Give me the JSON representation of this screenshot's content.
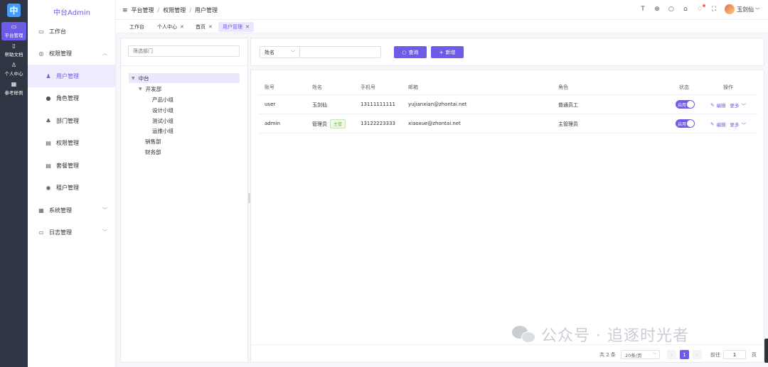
{
  "rail": {
    "logo": "中",
    "items": [
      {
        "label": "平台管理",
        "icon": "monitor-icon",
        "glyph": "▭",
        "active": true
      },
      {
        "label": "帮助文档",
        "icon": "document-icon",
        "glyph": "▯",
        "active": false
      },
      {
        "label": "个人中心",
        "icon": "person-icon",
        "glyph": "♙",
        "active": false
      },
      {
        "label": "参考样例",
        "icon": "grid-icon",
        "glyph": "▦",
        "active": false
      }
    ]
  },
  "menu": {
    "title": "中台Admin",
    "items": [
      {
        "label": "工作台",
        "glyph": "▭"
      },
      {
        "label": "权限管理",
        "glyph": "◎"
      },
      {
        "label": "用户管理",
        "glyph": "♟"
      },
      {
        "label": "角色管理",
        "glyph": "●"
      },
      {
        "label": "部门管理",
        "glyph": "♣"
      },
      {
        "label": "权限管理",
        "glyph": "▤"
      },
      {
        "label": "套餐管理",
        "glyph": "▤"
      },
      {
        "label": "租户管理",
        "glyph": "◉"
      },
      {
        "label": "系统管理",
        "glyph": "▦"
      },
      {
        "label": "日志管理",
        "glyph": "▭"
      }
    ]
  },
  "header": {
    "breadcrumb": [
      "平台管理",
      "权限管理",
      "用户管理"
    ],
    "icons": [
      "text-size-icon",
      "globe-icon",
      "search-icon",
      "shirt-icon",
      "bell-icon",
      "fullscreen-icon"
    ],
    "user_name": "玉剑仙"
  },
  "tabs": [
    {
      "label": "工作台",
      "closable": false,
      "active": false
    },
    {
      "label": "个人中心",
      "closable": true,
      "active": false
    },
    {
      "label": "首页",
      "closable": true,
      "active": false
    },
    {
      "label": "用户管理",
      "closable": true,
      "active": true
    }
  ],
  "dept": {
    "search_placeholder": "筛选部门",
    "tree": [
      {
        "label": "中台",
        "level": 0,
        "expanded": true,
        "selected": true
      },
      {
        "label": "开发部",
        "level": 1,
        "expanded": true
      },
      {
        "label": "产品小组",
        "level": 2
      },
      {
        "label": "设计小组",
        "level": 2
      },
      {
        "label": "测试小组",
        "level": 2
      },
      {
        "label": "运维小组",
        "level": 2
      },
      {
        "label": "销售部",
        "level": 1
      },
      {
        "label": "财务部",
        "level": 1
      }
    ]
  },
  "filter": {
    "field_select": "姓名",
    "keyword_value": "",
    "query_label": "查询",
    "add_label": "新增"
  },
  "table": {
    "columns": [
      "账号",
      "姓名",
      "手机号",
      "邮箱",
      "角色",
      "状态",
      "操作"
    ],
    "rows": [
      {
        "account": "user",
        "name": "玉剑仙",
        "tag": "",
        "phone": "13111111111",
        "email": "yujianxian@zhontai.net",
        "role": "普通员工",
        "status": "启用"
      },
      {
        "account": "admin",
        "name": "管理员",
        "tag": "主管",
        "phone": "13122223333",
        "email": "xiaoxue@zhontai.net",
        "role": "主管理员",
        "status": "启用"
      }
    ],
    "edit_label": "编辑",
    "more_label": "更多"
  },
  "pagination": {
    "total_text": "共 2 条",
    "page_size": "20条/页",
    "current_page": "1",
    "goto_label": "前往",
    "goto_value": "1",
    "page_unit": "页"
  },
  "watermark": "公众号 · 追逐时光者",
  "colors": {
    "accent": "#6c5ce7",
    "rail": "#2f3542",
    "tag_green": "#67c23a"
  }
}
